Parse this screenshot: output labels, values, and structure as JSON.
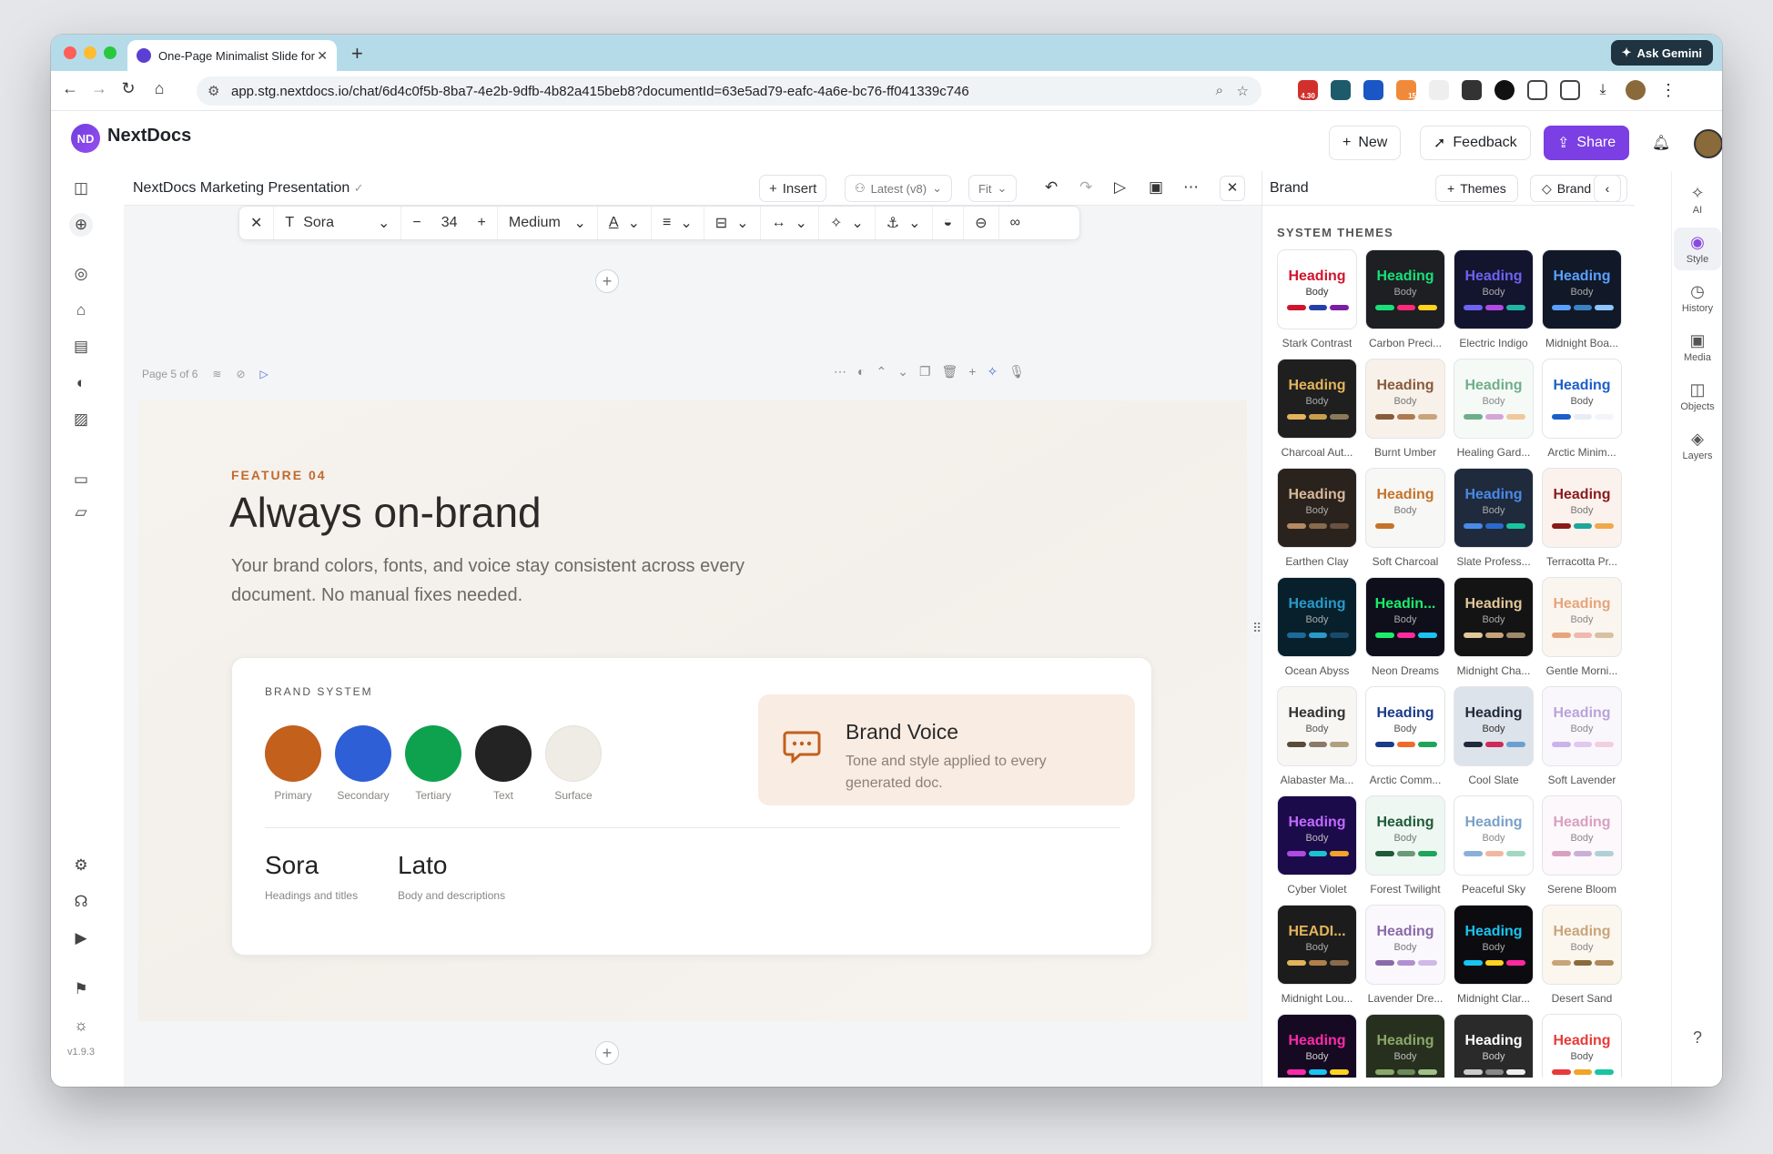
{
  "browser": {
    "tab_title": "One-Page Minimalist Slide for",
    "ask_gemini": "Ask Gemini",
    "url": "app.stg.nextdocs.io/chat/6d4c0f5b-8ba7-4e2b-9dfb-4b82a415beb8?documentId=63e5ad79-eafc-4a6e-bc76-ff041339c746",
    "ext_badge_1": "4.30",
    "ext_badge_2": "15"
  },
  "app": {
    "logo": "ND",
    "name": "NextDocs",
    "new_label": "New",
    "feedback_label": "Feedback",
    "share_label": "Share",
    "version": "v1.9.3"
  },
  "editor": {
    "doc_title": "NextDocs Marketing Presentation",
    "insert_label": "Insert",
    "version_label": "Latest (v8)",
    "zoom_label": "Fit"
  },
  "format": {
    "font": "Sora",
    "size": "34",
    "weight": "Medium"
  },
  "page": {
    "label": "Page 5 of 6"
  },
  "slide": {
    "kicker": "FEATURE 04",
    "title": "Always on-brand",
    "desc": "Your brand colors, fonts, and voice stay consistent across every document. No manual fixes needed.",
    "brand_system_label": "BRAND SYSTEM",
    "swatches": [
      {
        "label": "Primary",
        "color": "#c2601c"
      },
      {
        "label": "Secondary",
        "color": "#2f5fd6"
      },
      {
        "label": "Tertiary",
        "color": "#0ea24f"
      },
      {
        "label": "Text",
        "color": "#232323"
      },
      {
        "label": "Surface",
        "color": "#efebe5"
      }
    ],
    "voice_title": "Brand Voice",
    "voice_desc": "Tone and style applied to every generated doc.",
    "fonts": [
      {
        "name": "Sora",
        "desc": "Headings and titles"
      },
      {
        "name": "Lato",
        "desc": "Body and descriptions"
      }
    ]
  },
  "panel": {
    "title": "Brand",
    "themes_label": "Themes",
    "brandkits_label": "Brand Kits",
    "section": "SYSTEM THEMES",
    "themes": [
      {
        "name": "Stark Contrast",
        "heading": "Heading",
        "bg": "#ffffff",
        "hc": "#d0142c",
        "bc": "#333333",
        "bars": [
          "#d0142c",
          "#2440a8",
          "#7a1fa2"
        ]
      },
      {
        "name": "Carbon Preci...",
        "heading": "Heading",
        "bg": "#1d1f22",
        "hc": "#17e07a",
        "bc": "#aaaaaa",
        "bars": [
          "#17e07a",
          "#ff2a7a",
          "#ffd21f"
        ]
      },
      {
        "name": "Electric Indigo",
        "heading": "Heading",
        "bg": "#13142e",
        "hc": "#6e63f0",
        "bc": "#aaaaaa",
        "bars": [
          "#6e63f0",
          "#b04ae0",
          "#1fb5a5"
        ]
      },
      {
        "name": "Midnight Boa...",
        "heading": "Heading",
        "bg": "#111827",
        "hc": "#5aa0ff",
        "bc": "#aaaaaa",
        "bars": [
          "#5aa0ff",
          "#3b82c4",
          "#8ec5ff"
        ]
      },
      {
        "name": "Charcoal Aut...",
        "heading": "Heading",
        "bg": "#1f1f1f",
        "hc": "#e4b45a",
        "bc": "#aaaaaa",
        "bars": [
          "#e4b45a",
          "#c9a04a",
          "#8a7a5a"
        ]
      },
      {
        "name": "Burnt Umber",
        "heading": "Heading",
        "bg": "#f7f1ea",
        "hc": "#8a5a3a",
        "bc": "#777777",
        "bars": [
          "#8a5a3a",
          "#b07a50",
          "#c9a47a"
        ]
      },
      {
        "name": "Healing Gard...",
        "heading": "Heading",
        "bg": "#f6faf7",
        "hc": "#6fae8a",
        "bc": "#888888",
        "bars": [
          "#6fae8a",
          "#d8a4d8",
          "#f0c89a"
        ]
      },
      {
        "name": "Arctic Minim...",
        "heading": "Heading",
        "bg": "#ffffff",
        "hc": "#1d5fc8",
        "bc": "#555555",
        "bars": [
          "#1d5fc8",
          "#e8edf5",
          "#f3f5f9"
        ]
      },
      {
        "name": "Earthen Clay",
        "heading": "Heading",
        "bg": "#2a221c",
        "hc": "#d8b89a",
        "bc": "#aaaaaa",
        "bars": [
          "#b58a64",
          "#8a6a4e",
          "#6a5240"
        ]
      },
      {
        "name": "Soft Charcoal",
        "heading": "Heading",
        "bg": "#f7f7f5",
        "hc": "#c5732a",
        "bc": "#777777",
        "bars": [
          "#c5732a",
          "#f7f7f5",
          "#f7f7f5"
        ]
      },
      {
        "name": "Slate Profess...",
        "heading": "Heading",
        "bg": "#1f2a3c",
        "hc": "#4a8ae8",
        "bc": "#aaaaaa",
        "bars": [
          "#4a8ae8",
          "#2a6ad0",
          "#19c4a0"
        ]
      },
      {
        "name": "Terracotta Pr...",
        "heading": "Heading",
        "bg": "#fbf2ee",
        "hc": "#8a1a1a",
        "bc": "#777777",
        "bars": [
          "#8a1a1a",
          "#1fa59a",
          "#f0a84a"
        ]
      },
      {
        "name": "Ocean Abyss",
        "heading": "Heading",
        "bg": "#07202c",
        "hc": "#2a9ac8",
        "bc": "#aaaaaa",
        "bars": [
          "#1a6a9a",
          "#2a9ac8",
          "#1a4a6a"
        ]
      },
      {
        "name": "Neon Dreams",
        "heading": "Headin...",
        "bg": "#0f0f1c",
        "hc": "#19f06a",
        "bc": "#aaaaaa",
        "bars": [
          "#19f06a",
          "#ff2aa0",
          "#19c4f0"
        ]
      },
      {
        "name": "Midnight Cha...",
        "heading": "Heading",
        "bg": "#141414",
        "hc": "#e2c89a",
        "bc": "#aaaaaa",
        "bars": [
          "#e2c89a",
          "#c8a47a",
          "#a08a6a"
        ]
      },
      {
        "name": "Gentle Morni...",
        "heading": "Heading",
        "bg": "#fbf5f0",
        "hc": "#e5a47a",
        "bc": "#888888",
        "bars": [
          "#e5a47a",
          "#f0b8b0",
          "#d8c0a0"
        ]
      },
      {
        "name": "Alabaster Ma...",
        "heading": "Heading",
        "bg": "#f8f6f2",
        "hc": "#333333",
        "bc": "#555555",
        "bars": [
          "#5a4a3a",
          "#8a7a6a",
          "#b0a080"
        ]
      },
      {
        "name": "Arctic Comm...",
        "heading": "Heading",
        "bg": "#ffffff",
        "hc": "#1a3a8a",
        "bc": "#555555",
        "bars": [
          "#1a3a8a",
          "#f06a2a",
          "#1fa55a"
        ]
      },
      {
        "name": "Cool Slate",
        "heading": "Heading",
        "bg": "#dde3ea",
        "hc": "#1f2a3a",
        "bc": "#333333",
        "bars": [
          "#1f2a3a",
          "#d02a5a",
          "#6aa0d0"
        ]
      },
      {
        "name": "Soft Lavender",
        "heading": "Heading",
        "bg": "#faf7fc",
        "hc": "#b8a4d8",
        "bc": "#888888",
        "bars": [
          "#c8b4e8",
          "#e0c8f0",
          "#f0d0e0"
        ]
      },
      {
        "name": "Cyber Violet",
        "heading": "Heading",
        "bg": "#1c0b4a",
        "hc": "#c06aff",
        "bc": "#bbbbbb",
        "bars": [
          "#b04ae0",
          "#19c4d0",
          "#f0a42a"
        ]
      },
      {
        "name": "Forest Twilight",
        "heading": "Heading",
        "bg": "#eef7f1",
        "hc": "#1f5a3a",
        "bc": "#777777",
        "bars": [
          "#1f5a3a",
          "#6a9a7a",
          "#1fa55a"
        ]
      },
      {
        "name": "Peaceful Sky",
        "heading": "Heading",
        "bg": "#ffffff",
        "hc": "#7aa0c8",
        "bc": "#888888",
        "bars": [
          "#8ab0d8",
          "#f0b8a0",
          "#a0d8c0"
        ]
      },
      {
        "name": "Serene Bloom",
        "heading": "Heading",
        "bg": "#fdf8fb",
        "hc": "#d8a0c0",
        "bc": "#888888",
        "bars": [
          "#d8a0c0",
          "#c8b0d8",
          "#b0d0d8"
        ]
      },
      {
        "name": "Midnight Lou...",
        "heading": "HEADI...",
        "bg": "#1c1c1c",
        "hc": "#e2b45a",
        "bc": "#aaaaaa",
        "bars": [
          "#e2b45a",
          "#b0804a",
          "#8a6a4a"
        ]
      },
      {
        "name": "Lavender Dre...",
        "heading": "Heading",
        "bg": "#fbf8fd",
        "hc": "#8a6aa8",
        "bc": "#777777",
        "bars": [
          "#8a6aa8",
          "#b090d0",
          "#d0b8e8"
        ]
      },
      {
        "name": "Midnight Clar...",
        "heading": "Heading",
        "bg": "#0c0c10",
        "hc": "#19c4f0",
        "bc": "#aaaaaa",
        "bars": [
          "#19c4f0",
          "#ffd21f",
          "#ff2aa0"
        ]
      },
      {
        "name": "Desert Sand",
        "heading": "Heading",
        "bg": "#fbf6ee",
        "hc": "#c8a47a",
        "bc": "#888888",
        "bars": [
          "#c8a47a",
          "#8a6a3a",
          "#b08a5a"
        ]
      },
      {
        "name": "",
        "heading": "Heading",
        "bg": "#150a22",
        "hc": "#ff2aa8",
        "bc": "#cccccc",
        "bars": [
          "#ff2aa8",
          "#19c4f0",
          "#ffd21f"
        ]
      },
      {
        "name": "",
        "heading": "Heading",
        "bg": "#27301f",
        "hc": "#8aa86a",
        "bc": "#bbbbbb",
        "bars": [
          "#8aa86a",
          "#6a8a5a",
          "#a0c08a"
        ]
      },
      {
        "name": "",
        "heading": "Heading",
        "bg": "#2a2a2a",
        "hc": "#ffffff",
        "bc": "#cccccc",
        "bars": [
          "#cccccc",
          "#888888",
          "#eeeeee"
        ]
      },
      {
        "name": "",
        "heading": "Heading",
        "bg": "#ffffff",
        "hc": "#e83a3a",
        "bc": "#555555",
        "bars": [
          "#e83a3a",
          "#f0a42a",
          "#19c4a0"
        ]
      }
    ]
  },
  "rightrail": [
    {
      "label": "AI",
      "glyph": "✧"
    },
    {
      "label": "Style",
      "glyph": "◉"
    },
    {
      "label": "History",
      "glyph": "◷"
    },
    {
      "label": "Media",
      "glyph": "▣"
    },
    {
      "label": "Objects",
      "glyph": "◫"
    },
    {
      "label": "Layers",
      "glyph": "◈"
    }
  ],
  "help": "?"
}
